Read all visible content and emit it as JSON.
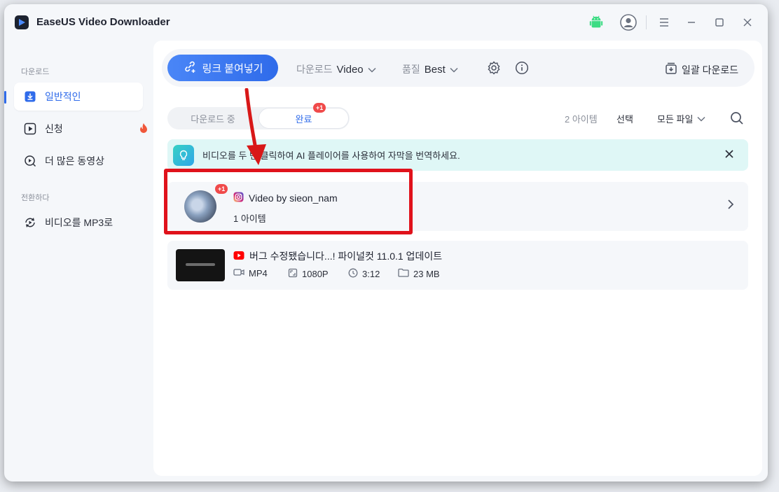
{
  "app": {
    "title": "EaseUS Video Downloader"
  },
  "sidebar": {
    "section_download": "다운로드",
    "section_convert": "전환하다",
    "items": [
      {
        "label": "일반적인"
      },
      {
        "label": "신청"
      },
      {
        "label": "더 많은 동영상"
      },
      {
        "label": "비디오를 MP3로"
      }
    ]
  },
  "toolbar": {
    "paste_label": "링크 붙여넣기",
    "download_label": "다운로드",
    "download_value": "Video",
    "quality_label": "품질",
    "quality_value": "Best",
    "batch_label": "일괄 다운로드"
  },
  "tabs": {
    "downloading": "다운로드 중",
    "completed": "완료",
    "completed_badge": "+1"
  },
  "list_controls": {
    "count": "2 아이템",
    "select": "선택",
    "filter": "모든 파일"
  },
  "notice": {
    "text": "비디오를 두 번 클릭하여 AI 플레이어를 사용하여 자막을 번역하세요."
  },
  "items": [
    {
      "title": "Video by sieon_nam",
      "subtitle": "1 아이템",
      "badge": "+1",
      "source_icon": "instagram-icon"
    },
    {
      "title": "버그 수정됐습니다...! 파이널컷 11.0.1 업데이트",
      "source_icon": "youtube-icon",
      "format": "MP4",
      "resolution": "1080P",
      "duration": "3:12",
      "size": "23 MB"
    }
  ],
  "colors": {
    "accent": "#2f6bea",
    "highlight": "#e0121b",
    "badge": "#f04a4a",
    "android": "#3ddc84"
  }
}
